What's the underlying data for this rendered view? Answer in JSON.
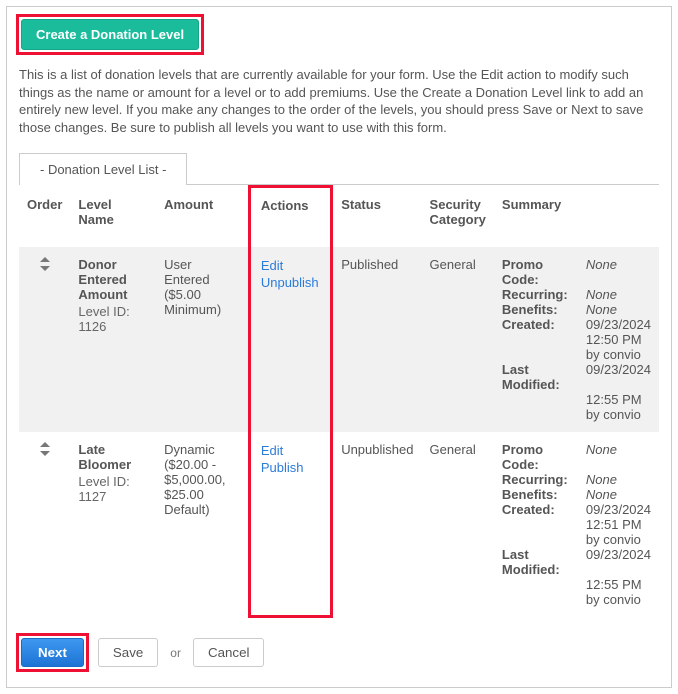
{
  "create_button": "Create a Donation Level",
  "intro": "This is a list of donation levels that are currently available for your form. Use the Edit action to modify such things as the name or amount for a level or to add premiums. Use the Create a Donation Level link to add an entirely new level. If you make any changes to the order of the levels, you should press Save or Next to save those changes. Be sure to publish all levels you want to use with this form.",
  "tab_label": "- Donation Level List -",
  "columns": {
    "order": "Order",
    "level_name": "Level Name",
    "amount": "Amount",
    "actions": "Actions",
    "status": "Status",
    "security": "Security Category",
    "summary": "Summary"
  },
  "rows": [
    {
      "name": "Donor Entered Amount",
      "level_id_label": "Level ID: 1126",
      "amount": "User Entered ($5.00 Minimum)",
      "action_edit": "Edit",
      "action_pub": "Unpublish",
      "status": "Published",
      "security": "General",
      "summary": {
        "promo_label": "Promo Code:",
        "promo_val": "None",
        "recurring_label": "Recurring:",
        "recurring_val": "None",
        "benefits_label": "Benefits:",
        "benefits_val": "None",
        "created_label": "Created:",
        "created_date": "09/23/2024",
        "created_time": "12:50 PM",
        "created_by": "by convio",
        "modified_label": "Last Modified:",
        "modified_date": "09/23/2024",
        "modified_time": "12:55 PM",
        "modified_by": "by convio"
      }
    },
    {
      "name": "Late Bloomer",
      "level_id_label": "Level ID: 1127",
      "amount": "Dynamic ($20.00 - $5,000.00, $25.00 Default)",
      "action_edit": "Edit",
      "action_pub": "Publish",
      "status": "Unpublished",
      "security": "General",
      "summary": {
        "promo_label": "Promo Code:",
        "promo_val": "None",
        "recurring_label": "Recurring:",
        "recurring_val": "None",
        "benefits_label": "Benefits:",
        "benefits_val": "None",
        "created_label": "Created:",
        "created_date": "09/23/2024",
        "created_time": "12:51 PM",
        "created_by": "by convio",
        "modified_label": "Last Modified:",
        "modified_date": "09/23/2024",
        "modified_time": "12:55 PM",
        "modified_by": "by convio"
      }
    }
  ],
  "footer": {
    "next": "Next",
    "save": "Save",
    "or": "or",
    "cancel": "Cancel"
  }
}
